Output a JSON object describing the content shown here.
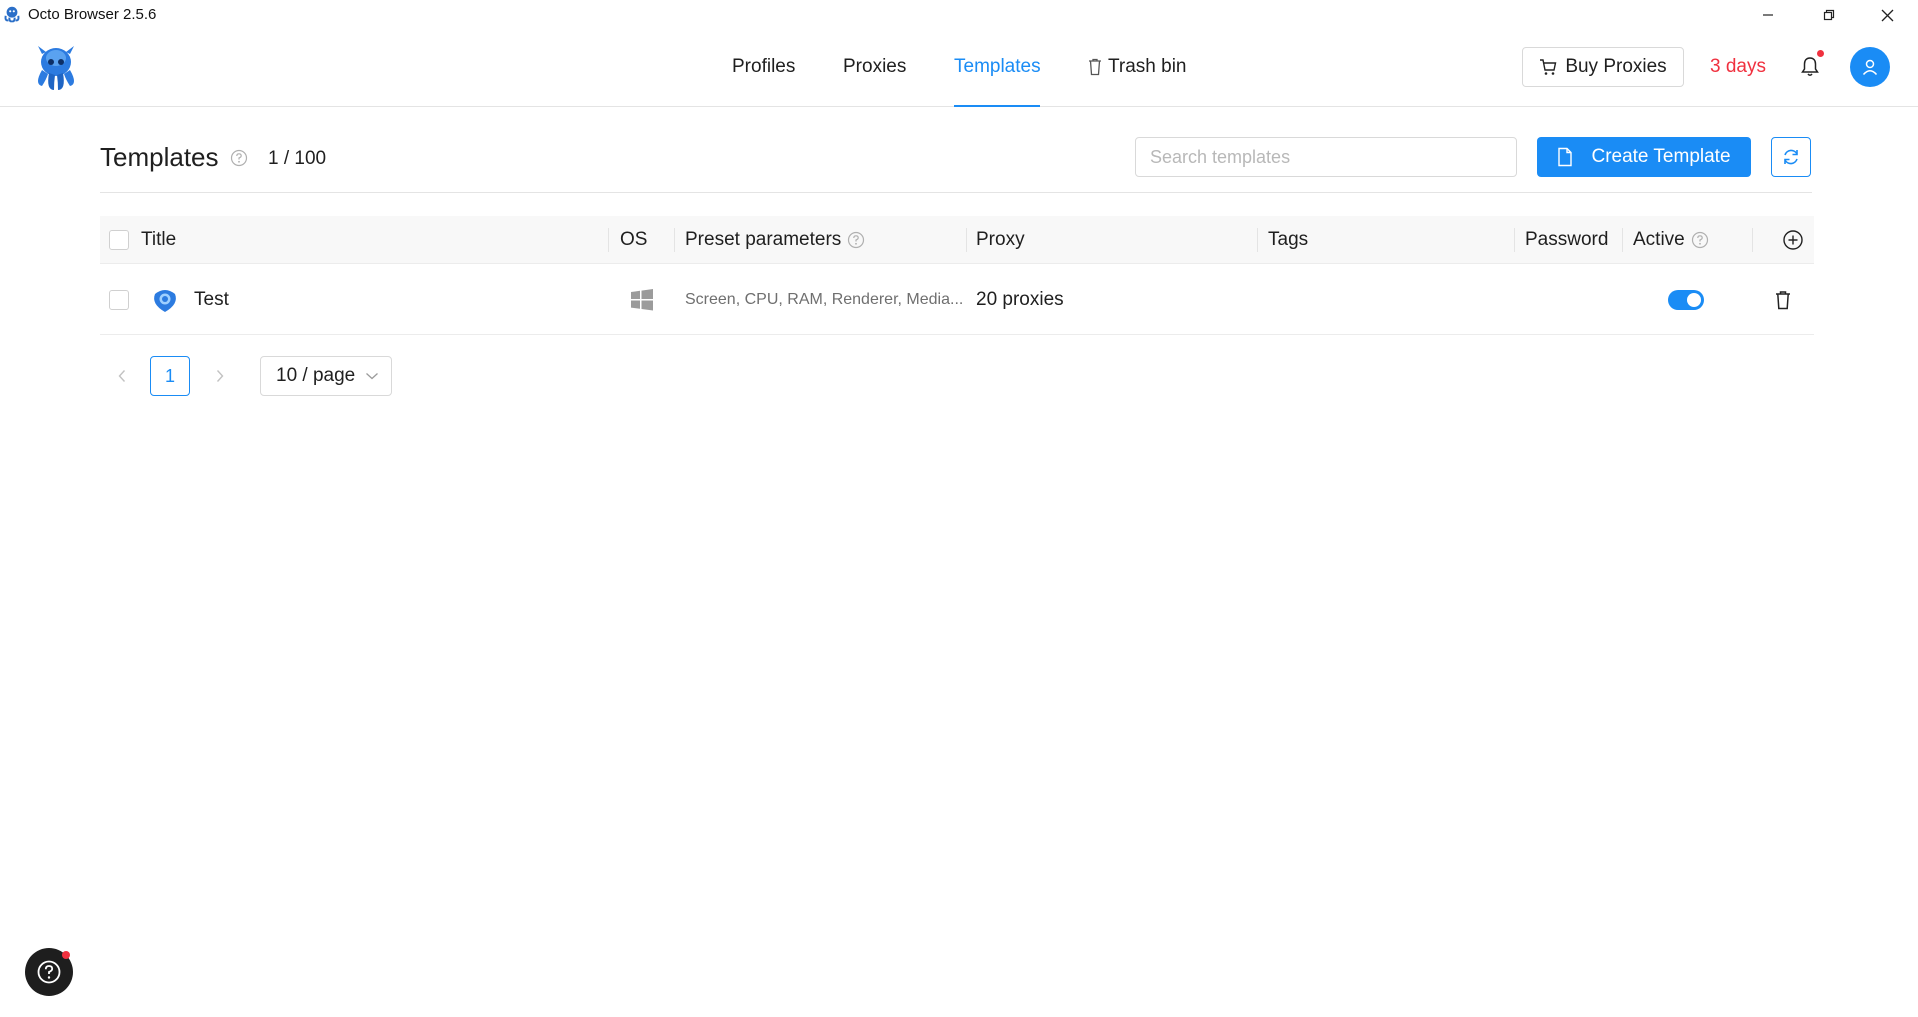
{
  "window": {
    "title": "Octo Browser 2.5.6"
  },
  "nav": {
    "tabs": [
      {
        "label": "Profiles"
      },
      {
        "label": "Proxies"
      },
      {
        "label": "Templates"
      },
      {
        "label": "Trash bin"
      }
    ],
    "active": "Templates"
  },
  "header": {
    "buy_proxies_label": "Buy Proxies",
    "subscription_remaining": "3 days"
  },
  "page": {
    "title": "Templates",
    "count": "1 / 100",
    "search_placeholder": "Search templates",
    "create_label": "Create Template"
  },
  "table": {
    "columns": [
      "Title",
      "OS",
      "Preset parameters",
      "Proxy",
      "Tags",
      "Password",
      "Active"
    ],
    "rows": [
      {
        "title": "Test",
        "os": "windows-icon",
        "preset": "Screen, CPU, RAM, Renderer, Media...",
        "proxy": "20 proxies",
        "tags": "",
        "password": "",
        "active": true
      }
    ]
  },
  "pagination": {
    "current_page": "1",
    "page_size": "10 / page"
  },
  "colors": {
    "accent": "#1a8cf5",
    "danger": "#f0313f"
  }
}
